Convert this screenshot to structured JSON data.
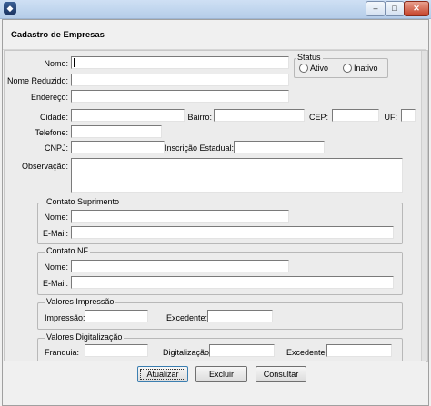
{
  "window": {
    "icon_glyph": "◆",
    "min_glyph": "–",
    "max_glyph": "□",
    "close_glyph": "✕"
  },
  "form": {
    "title": "Cadastro de Empresas",
    "fields": {
      "nome": "Nome:",
      "nome_reduzido": "Nome Reduzido:",
      "endereco": "Endereço:",
      "cidade": "Cidade:",
      "bairro": "Bairro:",
      "cep": "CEP:",
      "uf": "UF:",
      "telefone": "Telefone:",
      "cnpj": "CNPJ:",
      "inscricao": "Inscrição Estadual:",
      "observacao": "Observação:"
    },
    "status": {
      "title": "Status",
      "ativo": "Ativo",
      "inativo": "Inativo"
    },
    "contato_suprimento": {
      "title": "Contato Suprimento",
      "nome": "Nome:",
      "email": "E-Mail:"
    },
    "contato_nf": {
      "title": "Contato NF",
      "nome": "Nome:",
      "email": "E-Mail:"
    },
    "valores_impressao": {
      "title": "Valores Impressão",
      "impressao": "Impressão:",
      "excedente": "Excedente:"
    },
    "valores_digitalizacao": {
      "title": "Valores Digitalização",
      "franquia": "Franquia:",
      "digitalizacao": "Digitalização:",
      "excedente": "Excedente:"
    }
  },
  "buttons": {
    "atualizar": "Atualizar",
    "excluir": "Excluir",
    "consultar": "Consultar"
  }
}
